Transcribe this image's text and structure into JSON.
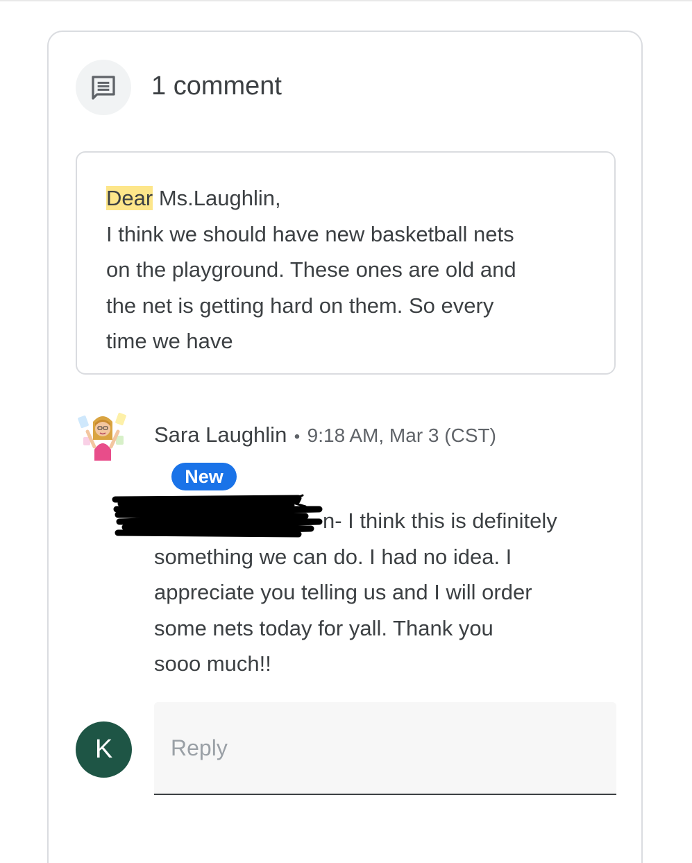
{
  "comments": {
    "count_label": "1 comment",
    "icon": "comment-icon"
  },
  "quote": {
    "highlight_word": "Dear",
    "lines": [
      " Ms.Laughlin,",
      "I think we should have new basketball nets",
      "on the playground. These ones are old and",
      "the net is getting hard on them. So every",
      "time we have"
    ]
  },
  "reply": {
    "author": "Sara Laughlin",
    "separator": "•",
    "timestamp": "9:18 AM, Mar 3 (CST)",
    "badge": "New",
    "lines": [
      "n- I think this is definitely",
      "something we can do.  I had no idea.  I",
      "appreciate you telling us and I will order",
      "some nets today for yall. Thank you",
      "sooo much!!"
    ]
  },
  "composer": {
    "avatar_letter": "K",
    "placeholder": "Reply"
  },
  "colors": {
    "badge": "#1a73e8",
    "highlight": "#fde68a",
    "avatar_k": "#1e5545"
  }
}
